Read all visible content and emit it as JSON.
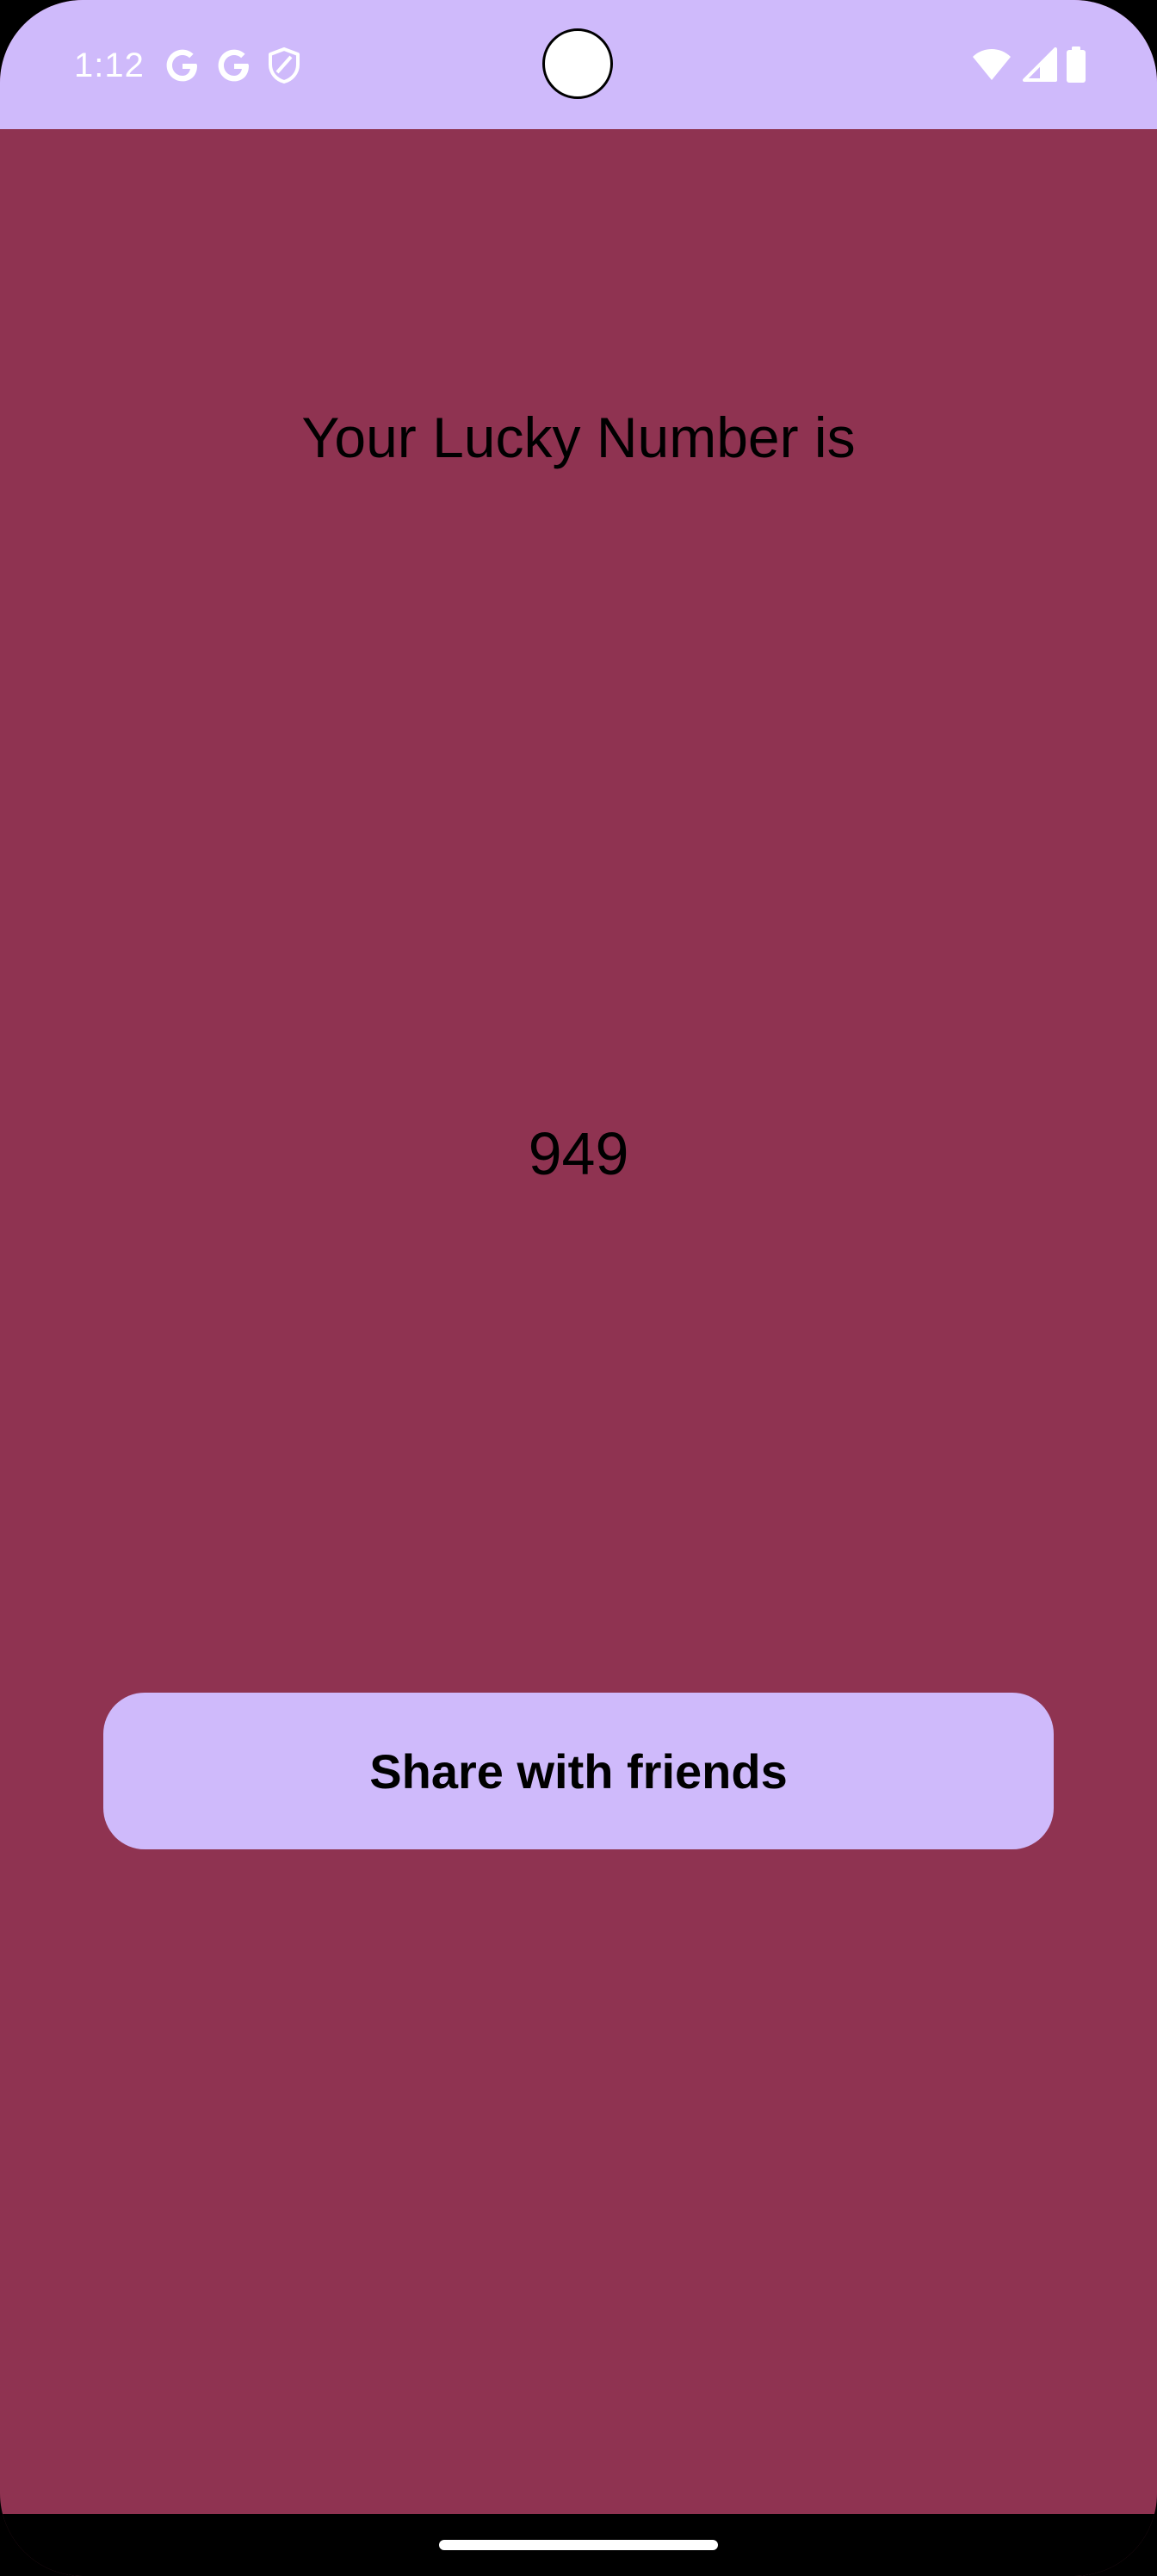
{
  "status_bar": {
    "time": "1:12",
    "left_icons": [
      "google-icon",
      "google-icon",
      "shield-icon"
    ],
    "right_icons": [
      "wifi-icon",
      "cellular-signal-icon",
      "battery-icon"
    ],
    "background_color": "#cfbafb"
  },
  "main": {
    "headline": "Your Lucky Number is",
    "lucky_number": "949",
    "share_button_label": "Share with friends",
    "background_color": "#8f3351",
    "button_color": "#cfbafb"
  },
  "nav_bar": {
    "handle": "home-gesture-handle"
  }
}
